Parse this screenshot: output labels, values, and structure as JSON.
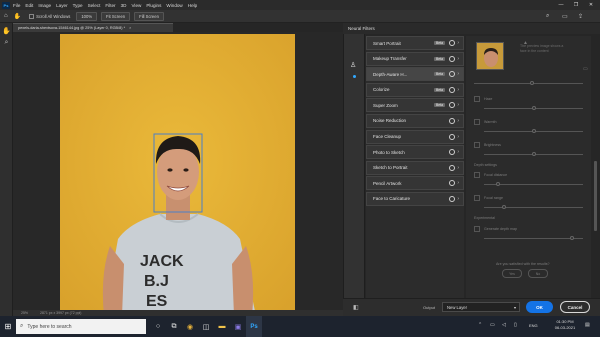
{
  "menu": [
    "File",
    "Edit",
    "Image",
    "Layer",
    "Type",
    "Select",
    "Filter",
    "3D",
    "View",
    "Plugins",
    "Window",
    "Help"
  ],
  "window_controls": [
    "—",
    "❐",
    "✕"
  ],
  "options_bar": {
    "home_icon": "home-icon",
    "scroll_all_label": "Scroll All Windows",
    "zoom_pct": "100%",
    "fit_screen": "Fit Screen",
    "fill_screen": "Fill Screen"
  },
  "document": {
    "tab_title": "pexels-daria-shevtsova-1546144.jpg @ 25% (Layer 0, RGB/8) *",
    "zoom": "25%",
    "status": "2871 px x 3997 px (72 ppi)"
  },
  "panel": {
    "title": "Neural Filters",
    "filters": [
      {
        "label": "Smart Portrait",
        "badge": "Beta",
        "selected": false
      },
      {
        "label": "Makeup Transfer",
        "badge": "Beta",
        "selected": false
      },
      {
        "label": "Depth-Aware H...",
        "badge": "Beta",
        "selected": true
      },
      {
        "label": "Colorize",
        "badge": "Beta",
        "selected": false
      },
      {
        "label": "Super Zoom",
        "badge": "Beta",
        "selected": false
      },
      {
        "label": "Noise Reduction",
        "badge": "",
        "selected": false
      },
      {
        "label": "Face Cleanup",
        "badge": "",
        "selected": false
      },
      {
        "label": "Photo to Sketch",
        "badge": "",
        "selected": false
      },
      {
        "label": "Sketch to Portrait",
        "badge": "",
        "selected": false
      },
      {
        "label": "Pencil Artwork",
        "badge": "",
        "selected": false
      },
      {
        "label": "Face to Caricature",
        "badge": "",
        "selected": false
      }
    ],
    "preview_text": "The preview image shows a face in the content",
    "settings": {
      "haze_label": "Haze",
      "warmth_label": "Warmth",
      "brightness_label": "Brightness",
      "depth_label": "Depth settings",
      "focal_label": "Focal distance",
      "focal_range_label": "Focal range",
      "generate_label": "Generate depth map",
      "experimental_label": "Experimental",
      "satisfied_q": "Are you satisfied with the results?",
      "yes": "Yes",
      "no": "No"
    },
    "output_label": "Output",
    "output_value": "New Layer",
    "ok": "OK",
    "cancel": "Cancel"
  },
  "taskbar": {
    "search_placeholder": "Type here to search",
    "lang": "ENG",
    "time": "01:30 PM",
    "date": "06-03-2021"
  },
  "colors": {
    "accent": "#1473e6",
    "photo_bg": "#e1ac31",
    "panel_bg": "#2b2b2b"
  }
}
